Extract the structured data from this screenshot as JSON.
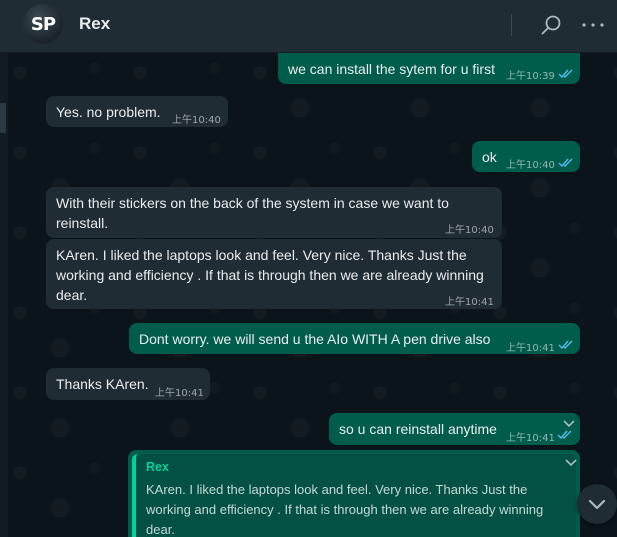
{
  "header": {
    "avatar_text": "SP",
    "contact_name": "Rex"
  },
  "messages": [
    {
      "dir": "out",
      "text": "we can install the sytem for u first",
      "time": "上午10:39",
      "read": true
    },
    {
      "dir": "in",
      "text": "Yes. no problem.",
      "time": "上午10:40"
    },
    {
      "dir": "out",
      "text": "ok",
      "time": "上午10:40",
      "read": true
    },
    {
      "dir": "in",
      "text": "With their stickers on the back of the system in case we want to reinstall.",
      "time": "上午10:40"
    },
    {
      "dir": "in",
      "text": "KAren. I liked the laptops look and feel. Very nice. Thanks Just the working and efficiency . If that is through then we are already winning dear.",
      "time": "上午10:41"
    },
    {
      "dir": "out",
      "text": "Dont worry. we will send u the AIo WITH A pen drive also",
      "time": "上午10:41",
      "read": true
    },
    {
      "dir": "in",
      "text": "Thanks KAren.",
      "time": "上午10:41"
    },
    {
      "dir": "out",
      "text": "so u can reinstall anytime",
      "time": "上午10:41",
      "read": true
    }
  ],
  "reply_quote": {
    "author": "Rex",
    "text": "KAren. I liked the laptops look and feel. Very nice. Thanks Just the working and efficiency . If that is through then we are already winning dear."
  },
  "colors": {
    "incoming": "#202c33",
    "outgoing": "#005c4b",
    "read_ticks": "#53bdeb",
    "quote_accent": "#06cf9c"
  },
  "icons": [
    "search-icon",
    "menu-icon",
    "double-check-icon",
    "chevron-down-icon"
  ]
}
